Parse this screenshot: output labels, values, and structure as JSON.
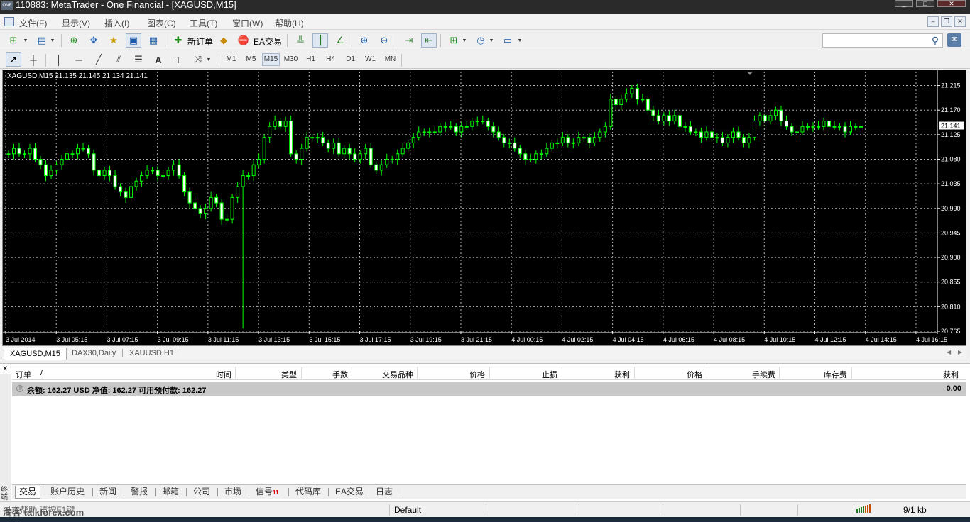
{
  "window": {
    "title": "110883: MetaTrader - One Financial - [XAGUSD,M15]",
    "logo": "ONE"
  },
  "menu": [
    "文件(F)",
    "显示(V)",
    "插入(I)",
    "图表(C)",
    "工具(T)",
    "窗口(W)",
    "帮助(H)"
  ],
  "toolbar": {
    "new_order": "新订单",
    "ea_trading": "EA交易"
  },
  "drawing_toolbar": {
    "text_tool": "A",
    "label_tool": "T",
    "timeframes": [
      "M1",
      "M5",
      "M15",
      "M30",
      "H1",
      "H4",
      "D1",
      "W1",
      "MN"
    ],
    "active_timeframe": "M15"
  },
  "chart_header": "XAGUSD,M15  21.135 21.145 21.134 21.141",
  "chart_data": {
    "type": "candlestick",
    "symbol": "XAGUSD",
    "timeframe": "M15",
    "ohlc_last": {
      "open": 21.135,
      "high": 21.145,
      "low": 21.134,
      "close": 21.141
    },
    "current_price": "21.141",
    "price_ticks": [
      "21.215",
      "21.170",
      "21.125",
      "21.080",
      "21.035",
      "20.990",
      "20.945",
      "20.900",
      "20.855",
      "20.810",
      "20.765"
    ],
    "time_ticks": [
      "3 Jul 2014",
      "3 Jul 05:15",
      "3 Jul 07:15",
      "3 Jul 09:15",
      "3 Jul 11:15",
      "3 Jul 13:15",
      "3 Jul 15:15",
      "3 Jul 17:15",
      "3 Jul 19:15",
      "3 Jul 21:15",
      "4 Jul 00:15",
      "4 Jul 02:15",
      "4 Jul 04:15",
      "4 Jul 06:15",
      "4 Jul 08:15",
      "4 Jul 10:15",
      "4 Jul 12:15",
      "4 Jul 14:15",
      "4 Jul 16:15"
    ],
    "ylim": [
      20.765,
      21.23
    ],
    "closes": [
      21.09,
      21.1,
      21.09,
      21.09,
      21.1,
      21.08,
      21.07,
      21.05,
      21.06,
      21.07,
      21.08,
      21.09,
      21.09,
      21.1,
      21.1,
      21.09,
      21.06,
      21.05,
      21.06,
      21.05,
      21.03,
      21.02,
      21.01,
      21.03,
      21.04,
      21.05,
      21.06,
      21.06,
      21.05,
      21.05,
      21.06,
      21.07,
      21.05,
      21.02,
      21.0,
      20.99,
      20.98,
      20.99,
      21.01,
      21.0,
      20.97,
      20.97,
      21.01,
      21.03,
      21.05,
      21.05,
      21.07,
      21.08,
      21.12,
      21.14,
      21.15,
      21.14,
      21.15,
      21.09,
      21.08,
      21.1,
      21.12,
      21.12,
      21.12,
      21.11,
      21.1,
      21.11,
      21.09,
      21.1,
      21.09,
      21.08,
      21.09,
      21.1,
      21.07,
      21.06,
      21.07,
      21.08,
      21.08,
      21.09,
      21.1,
      21.11,
      21.12,
      21.13,
      21.13,
      21.13,
      21.13,
      21.14,
      21.14,
      21.14,
      21.13,
      21.14,
      21.14,
      21.15,
      21.15,
      21.15,
      21.14,
      21.13,
      21.12,
      21.11,
      21.11,
      21.1,
      21.09,
      21.08,
      21.08,
      21.09,
      21.09,
      21.1,
      21.11,
      21.11,
      21.12,
      21.11,
      21.11,
      21.12,
      21.12,
      21.11,
      21.12,
      21.13,
      21.14,
      21.19,
      21.18,
      21.19,
      21.2,
      21.21,
      21.19,
      21.19,
      21.17,
      21.16,
      21.15,
      21.16,
      21.15,
      21.16,
      21.14,
      21.14,
      21.13,
      21.13,
      21.12,
      21.13,
      21.12,
      21.12,
      21.11,
      21.12,
      21.13,
      21.12,
      21.11,
      21.12,
      21.15,
      21.16,
      21.15,
      21.16,
      21.17,
      21.15,
      21.14,
      21.13,
      21.13,
      21.14,
      21.14,
      21.14,
      21.14,
      21.15,
      21.14,
      21.14,
      21.14,
      21.13,
      21.14,
      21.14,
      21.14
    ]
  },
  "chart_tabs": [
    {
      "label": "XAGUSD,M15",
      "active": true
    },
    {
      "label": "DAX30,Daily",
      "active": false
    },
    {
      "label": "XAUUSD,H1",
      "active": false
    }
  ],
  "terminal": {
    "columns": [
      "订单",
      "/",
      "时间",
      "类型",
      "手数",
      "交易品种",
      "价格",
      "止损",
      "获利",
      "价格",
      "手续费",
      "库存费",
      "获利"
    ],
    "balance_line": "余额: 162.27 USD  净值: 162.27  可用预付款: 162.27",
    "balance_profit": "0.00",
    "side_label": "终端",
    "tabs": [
      {
        "label": "交易",
        "active": true
      },
      {
        "label": "账户历史"
      },
      {
        "label": "新闻"
      },
      {
        "label": "警报"
      },
      {
        "label": "邮箱"
      },
      {
        "label": "公司"
      },
      {
        "label": "市场"
      },
      {
        "label": "信号",
        "badge": "11"
      },
      {
        "label": "代码库"
      },
      {
        "label": "EA交易"
      },
      {
        "label": "日志"
      }
    ]
  },
  "statusbar": {
    "help_text": "寻求帮助,请按F1键",
    "profile": "Default",
    "traffic": "9/1 kb",
    "watermark": "淘客 talkforex.com"
  },
  "colors": {
    "chart_bg": "#000000",
    "grid": "#b4b4b4",
    "candle_up": "#00ff00",
    "candle_body_bull": "#000000",
    "candle_body_bear": "#ffffff",
    "axis_text": "#ffffff",
    "price_marker_bg": "#ffffff"
  }
}
